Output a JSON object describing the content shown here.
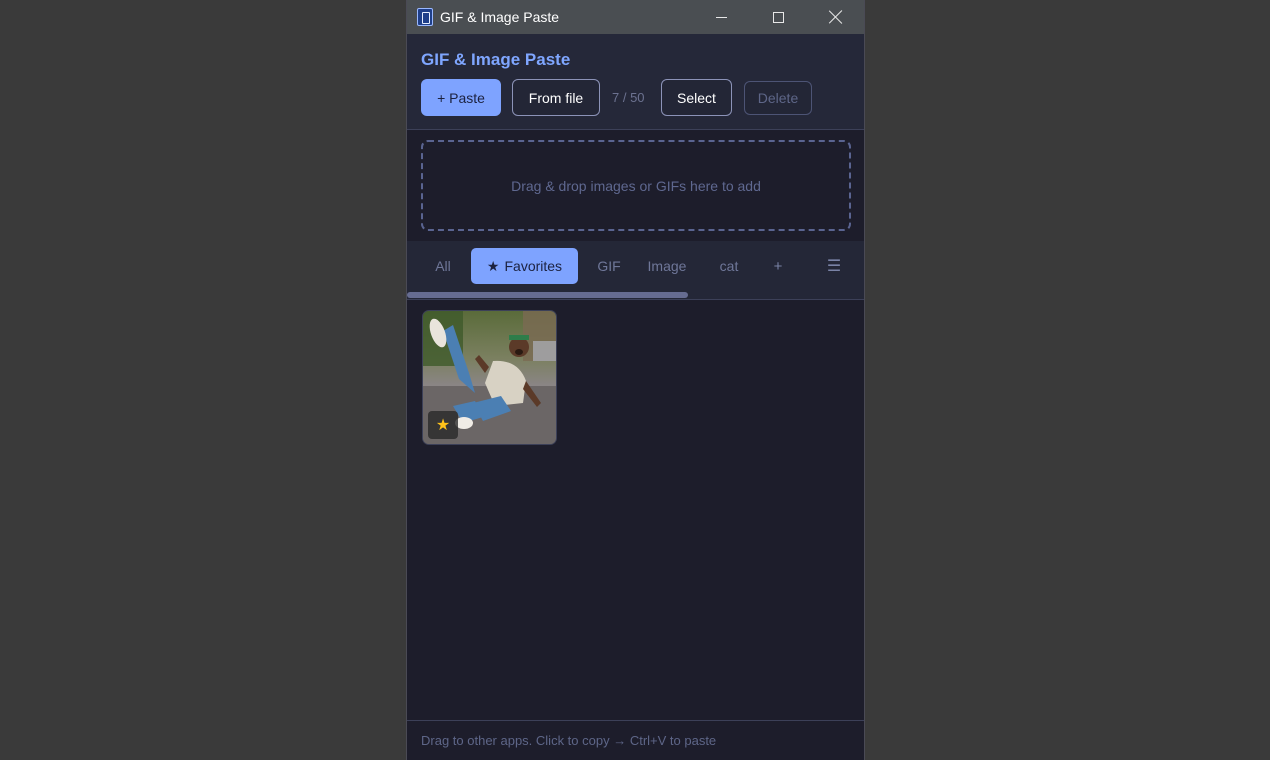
{
  "window": {
    "title": "GIF & Image Paste"
  },
  "header": {
    "heading": "GIF & Image Paste",
    "paste_label": "+ Paste",
    "from_file_label": "From file",
    "counter": "7 / 50",
    "select_label": "Select",
    "delete_label": "Delete"
  },
  "dropzone": {
    "text": "Drag & drop images or GIFs here to add"
  },
  "tabs": {
    "items": [
      {
        "label": "All",
        "active": false
      },
      {
        "label": "Favorites",
        "icon": "star-icon",
        "active": true
      },
      {
        "label": "GIF",
        "active": false
      },
      {
        "label": "Image",
        "active": false
      },
      {
        "label": "cat",
        "active": false
      }
    ],
    "add_label": "+",
    "menu_icon": "menu-icon",
    "star_glyph": "★",
    "menu_glyph": "☰"
  },
  "grid": {
    "items": [
      {
        "favorite": true,
        "badge_glyph": "★"
      }
    ]
  },
  "footer": {
    "hint": "Drag to other apps. Click to copy → Ctrl+V to paste"
  },
  "colors": {
    "accent": "#7ea3ff",
    "background": "#1d1d2b",
    "favorite_star": "#ffc21a"
  }
}
